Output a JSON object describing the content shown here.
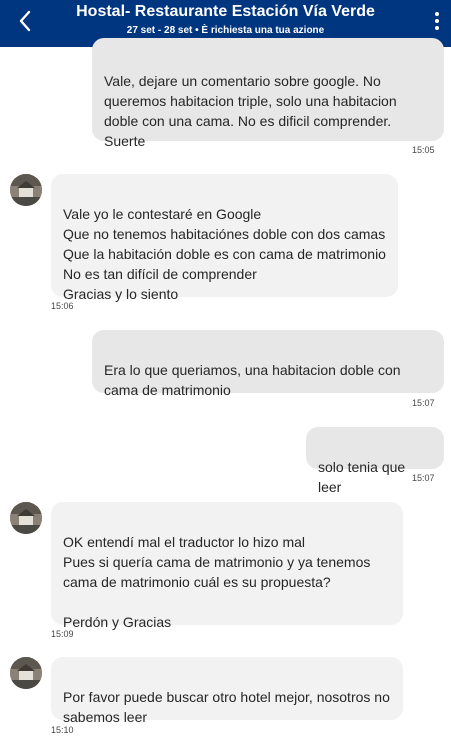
{
  "header": {
    "title": "Hostal- Restaurante Estación Vía Verde",
    "subtitle": "27 set - 28 set • È richiesta una tua azione"
  },
  "messages": [
    {
      "sender": "user",
      "text": "Vale, dejare un comentario sobre google. No queremos habitacion triple, solo una habitacion doble con una cama. No es dificil comprender. Suerte",
      "time": "15:05"
    },
    {
      "sender": "host",
      "text": "Vale yo le contestaré en Google\nQue no tenemos habitaciónes doble con dos camas\nQue la habitación doble es con cama de matrimonio\nNo es tan difícil de comprender\nGracias y lo siento",
      "time": "15:06"
    },
    {
      "sender": "user",
      "text": "Era lo que queriamos, una habitacion doble con cama de matrimonio",
      "time": "15:07"
    },
    {
      "sender": "user",
      "text": "solo tenia que leer",
      "time": "15:07"
    },
    {
      "sender": "host",
      "text": "OK entendí mal el traductor lo hizo mal\nPues si quería cama de matrimonio y ya tenemos cama de matrimonio cuál es su propuesta?\n\nPerdón y Gracias",
      "time": "15:09"
    },
    {
      "sender": "host",
      "text": "Por favor puede buscar otro hotel mejor, nosotros no sabemos leer",
      "time": "15:10"
    }
  ],
  "colors": {
    "header_bg": "#003580",
    "bubble_out": "#e7e7e7",
    "bubble_in": "#f2f2f2"
  }
}
